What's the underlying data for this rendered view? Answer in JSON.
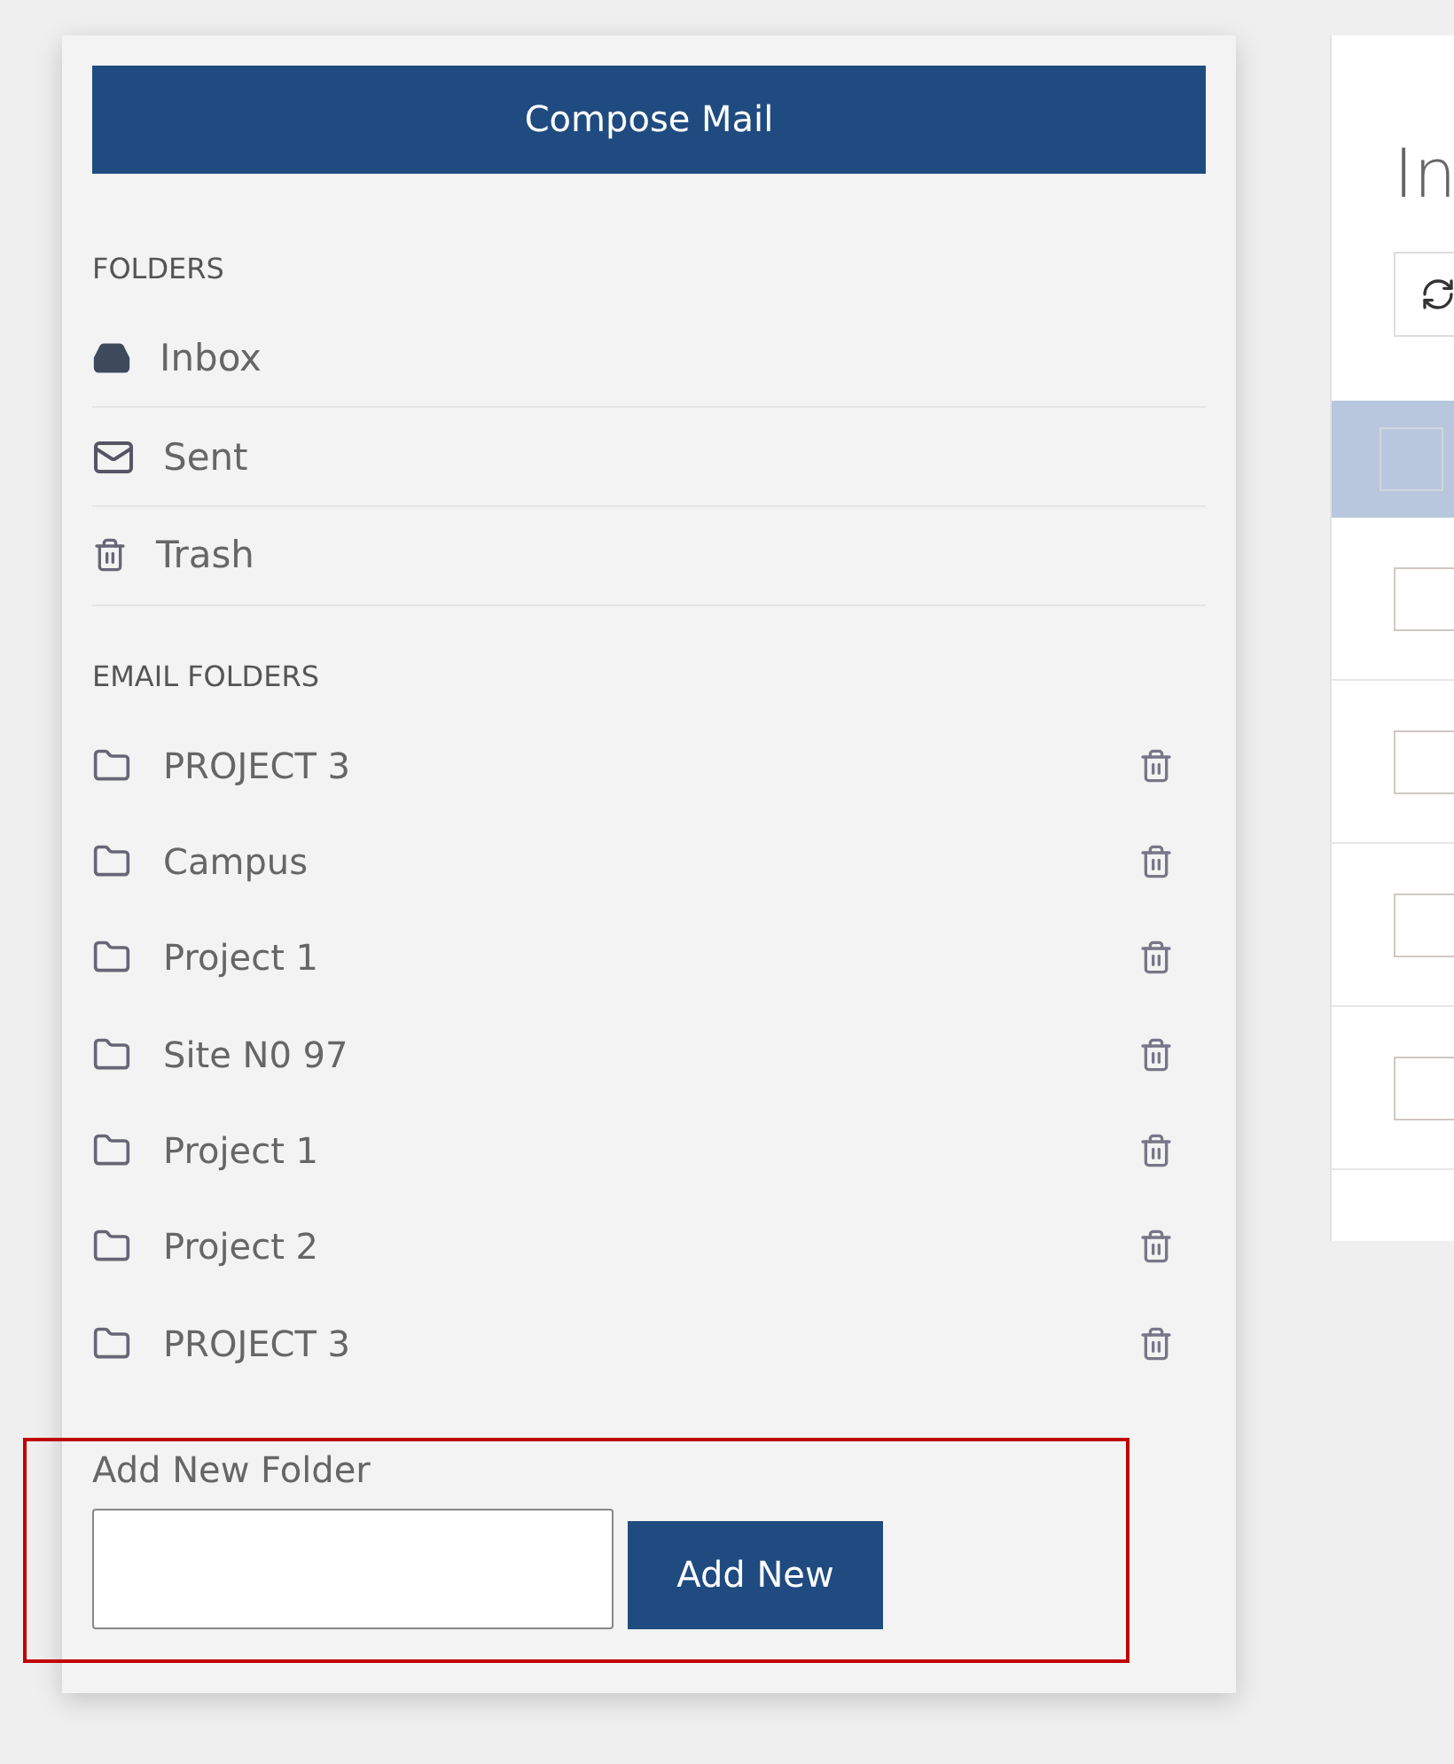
{
  "compose_button": "Compose Mail",
  "folders": {
    "heading": "FOLDERS",
    "items": [
      {
        "kind": "inbox",
        "label": "Inbox"
      },
      {
        "kind": "sent",
        "label": "Sent"
      },
      {
        "kind": "trash",
        "label": "Trash"
      }
    ]
  },
  "email_folders": {
    "heading": "EMAIL FOLDERS",
    "items": [
      {
        "label": "PROJECT 3"
      },
      {
        "label": "Campus"
      },
      {
        "label": "Project 1"
      },
      {
        "label": "Site N0 97"
      },
      {
        "label": "Project 1"
      },
      {
        "label": "Project 2"
      },
      {
        "label": "PROJECT 3"
      }
    ]
  },
  "add_folder": {
    "label": "Add New Folder",
    "button": "Add New"
  },
  "mail_panel": {
    "title": "In",
    "header_checkbox": {
      "checked": false
    },
    "rows": [
      {
        "checked": false
      },
      {
        "checked": false
      },
      {
        "checked": false
      },
      {
        "checked": false
      }
    ]
  }
}
